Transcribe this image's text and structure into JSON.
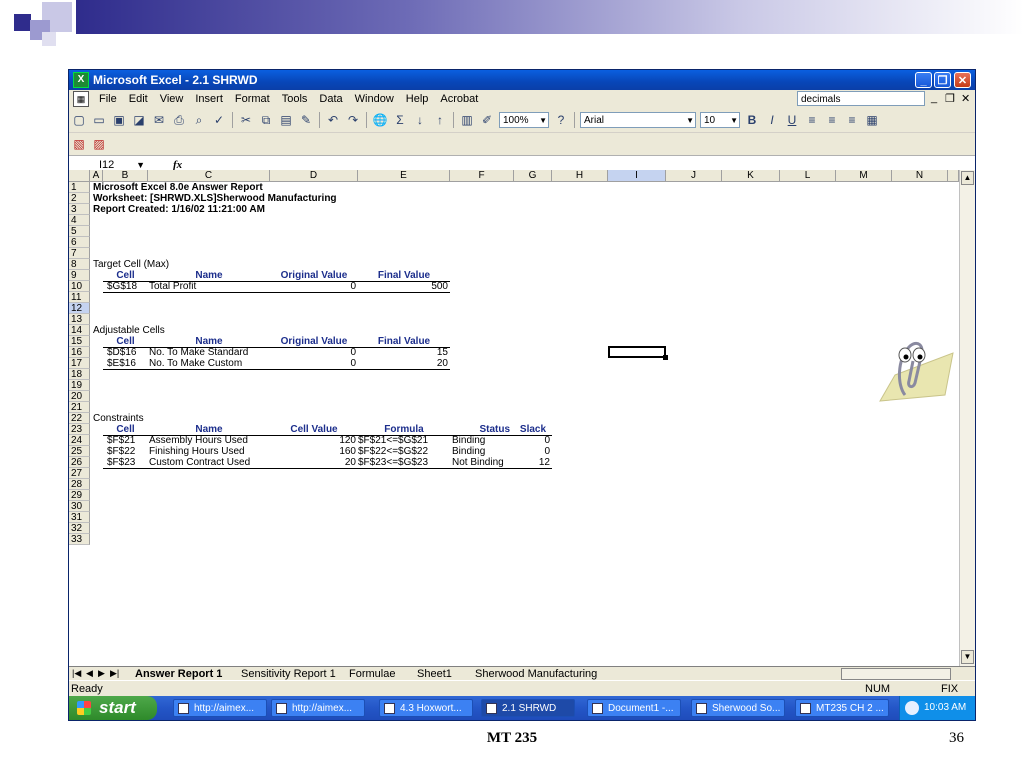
{
  "slide": {
    "footer_title": "MT 235",
    "page_number": "36"
  },
  "window": {
    "title": "Microsoft Excel - 2.1 SHRWD",
    "controls": {
      "minimize": "_",
      "restore": "❐",
      "close": "✕"
    }
  },
  "menu": {
    "items": [
      "File",
      "Edit",
      "View",
      "Insert",
      "Format",
      "Tools",
      "Data",
      "Window",
      "Help",
      "Acrobat"
    ],
    "help_value": "decimals"
  },
  "toolbar": {
    "zoom": "100%",
    "font": "Arial",
    "size": "10"
  },
  "formula_bar": {
    "cell_ref": "I12",
    "fx": "fx",
    "value": ""
  },
  "columns": [
    "A",
    "B",
    "C",
    "D",
    "E",
    "F",
    "G",
    "H",
    "I",
    "J",
    "K",
    "L",
    "M",
    "N"
  ],
  "rows": [
    "1",
    "2",
    "3",
    "4",
    "5",
    "6",
    "7",
    "8",
    "9",
    "10",
    "11",
    "12",
    "13",
    "14",
    "15",
    "16",
    "17",
    "18",
    "19",
    "20",
    "21",
    "22",
    "23",
    "24",
    "25",
    "26",
    "27",
    "28",
    "29",
    "30",
    "31",
    "32",
    "33"
  ],
  "report": {
    "line1": "Microsoft Excel 8.0e Answer Report",
    "line2": "Worksheet: [SHRWD.XLS]Sherwood Manufacturing",
    "line3": "Report Created: 1/16/02 11:21:00 AM",
    "target": {
      "title": "Target Cell (Max)",
      "headers": [
        "Cell",
        "Name",
        "Original Value",
        "Final Value"
      ],
      "rows": [
        [
          "$G$18",
          "Total Profit",
          "0",
          "500"
        ]
      ]
    },
    "adjustable": {
      "title": "Adjustable Cells",
      "headers": [
        "Cell",
        "Name",
        "Original Value",
        "Final Value"
      ],
      "rows": [
        [
          "$D$16",
          "No. To Make Standard",
          "0",
          "15"
        ],
        [
          "$E$16",
          "No. To Make Custom",
          "0",
          "20"
        ]
      ]
    },
    "constraints": {
      "title": "Constraints",
      "headers": [
        "Cell",
        "Name",
        "Cell Value",
        "Formula",
        "Status",
        "Slack"
      ],
      "rows": [
        [
          "$F$21",
          "Assembly Hours Used",
          "120",
          "$F$21<=$G$21",
          "Binding",
          "0"
        ],
        [
          "$F$22",
          "Finishing Hours Used",
          "160",
          "$F$22<=$G$22",
          "Binding",
          "0"
        ],
        [
          "$F$23",
          "Custom Contract Used",
          "20",
          "$F$23<=$G$23",
          "Not Binding",
          "12"
        ]
      ]
    }
  },
  "sheet_tabs": [
    "Answer Report 1",
    "Sensitivity Report 1",
    "Formulae",
    "Sheet1",
    "Sherwood Manufacturing"
  ],
  "status": {
    "left": "Ready",
    "num": "NUM",
    "fix": "FIX"
  },
  "taskbar": {
    "start": "start",
    "tasks": [
      "http://aimex...",
      "http://aimex...",
      "4.3 Hoxwort...",
      "2.1 SHRWD",
      "Document1 -...",
      "Sherwood So...",
      "MT235 CH 2 ..."
    ],
    "clock": "10:03 AM"
  },
  "colors": {
    "accent": "#1c2e8c",
    "titlebar": "#0a5fe0",
    "taskbar": "#2456c7"
  }
}
